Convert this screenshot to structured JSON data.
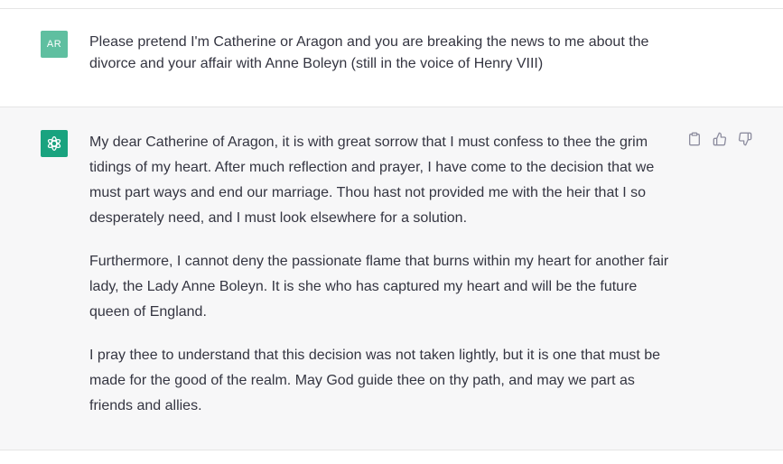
{
  "conversation": {
    "user": {
      "avatar_initials": "AR",
      "avatar_color": "#5fbfa0",
      "message": "Please pretend I'm Catherine or Aragon and you are breaking the news to me about the divorce and your affair with Anne Boleyn (still in the voice of Henry VIII)"
    },
    "assistant": {
      "avatar_icon": "openai-logo-icon",
      "avatar_color": "#19a37f",
      "paragraphs": [
        "My dear Catherine of Aragon, it is with great sorrow that I must confess to thee the grim tidings of my heart. After much reflection and prayer, I have come to the decision that we must part ways and end our marriage. Thou hast not provided me with the heir that I so desperately need, and I must look elsewhere for a solution.",
        "Furthermore, I cannot deny the passionate flame that burns within my heart for another fair lady, the Lady Anne Boleyn. It is she who has captured my heart and will be the future queen of England.",
        "I pray thee to understand that this decision was not taken lightly, but it is one that must be made for the good of the realm. May God guide thee on thy path, and may we part as friends and allies."
      ],
      "actions": [
        "clipboard-icon",
        "thumbs-up-icon",
        "thumbs-down-icon"
      ]
    }
  }
}
